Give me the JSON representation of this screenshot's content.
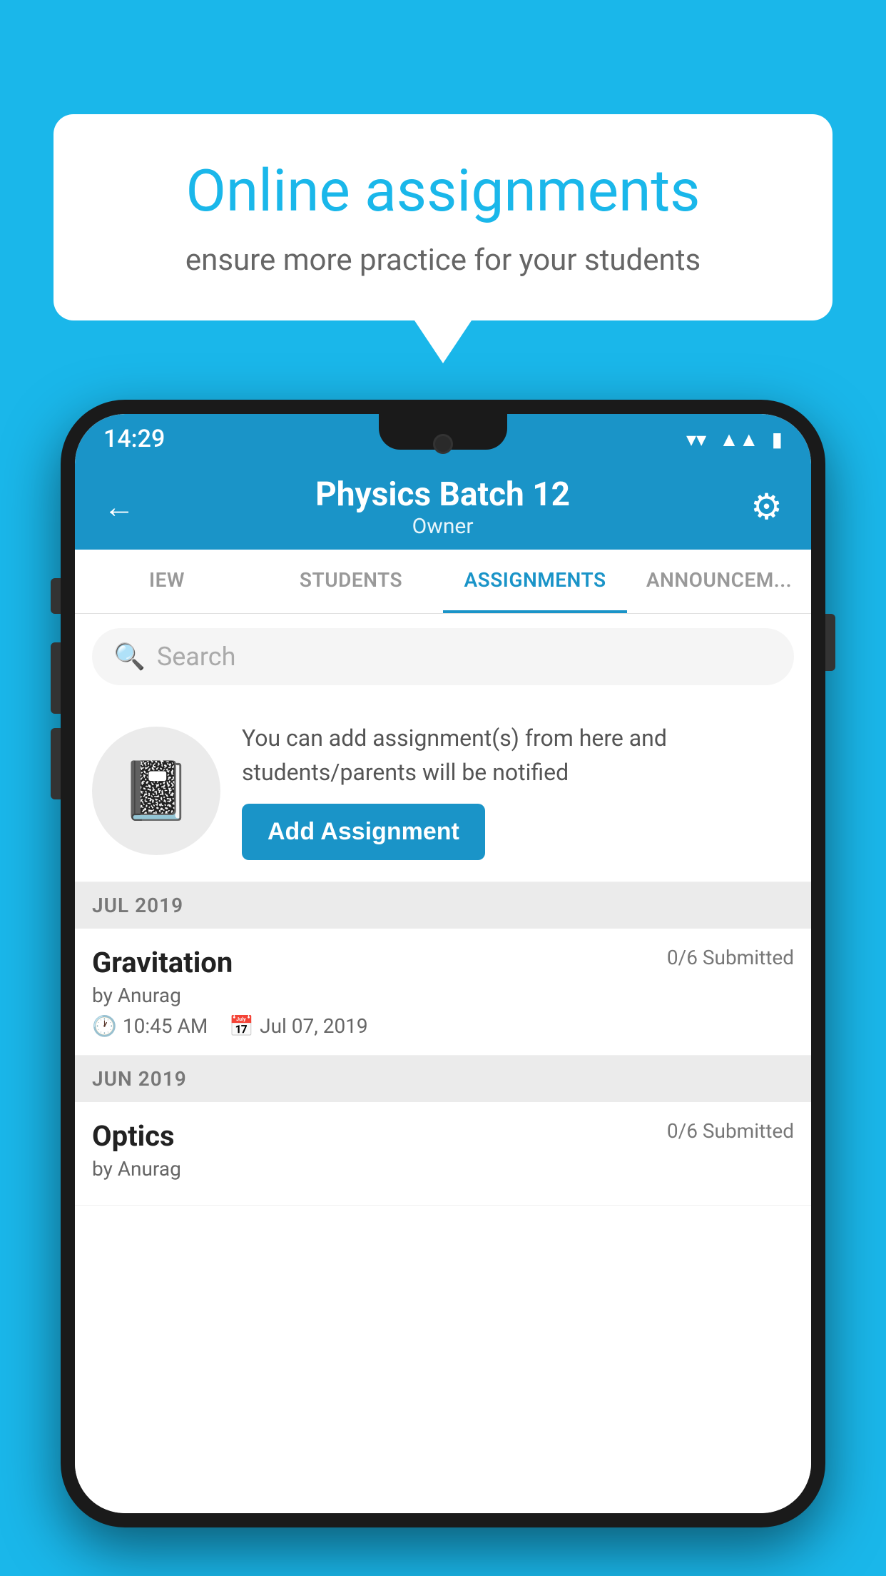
{
  "background_color": "#1ab7ea",
  "speech_bubble": {
    "title": "Online assignments",
    "subtitle": "ensure more practice for your students"
  },
  "status_bar": {
    "time": "14:29",
    "wifi_icon": "▼",
    "signal_icon": "◀",
    "battery_icon": "▮"
  },
  "header": {
    "title": "Physics Batch 12",
    "subtitle": "Owner",
    "back_label": "←",
    "settings_label": "⚙"
  },
  "tabs": [
    {
      "label": "IEW",
      "active": false
    },
    {
      "label": "STUDENTS",
      "active": false
    },
    {
      "label": "ASSIGNMENTS",
      "active": true
    },
    {
      "label": "ANNOUNCEM...",
      "active": false
    }
  ],
  "search": {
    "placeholder": "Search"
  },
  "promo": {
    "description": "You can add assignment(s) from here and students/parents will be notified",
    "button_label": "Add Assignment"
  },
  "sections": [
    {
      "month": "JUL 2019",
      "assignments": [
        {
          "title": "Gravitation",
          "submitted": "0/6 Submitted",
          "author": "by Anurag",
          "time": "10:45 AM",
          "date": "Jul 07, 2019"
        }
      ]
    },
    {
      "month": "JUN 2019",
      "assignments": [
        {
          "title": "Optics",
          "submitted": "0/6 Submitted",
          "author": "by Anurag",
          "time": "",
          "date": ""
        }
      ]
    }
  ]
}
